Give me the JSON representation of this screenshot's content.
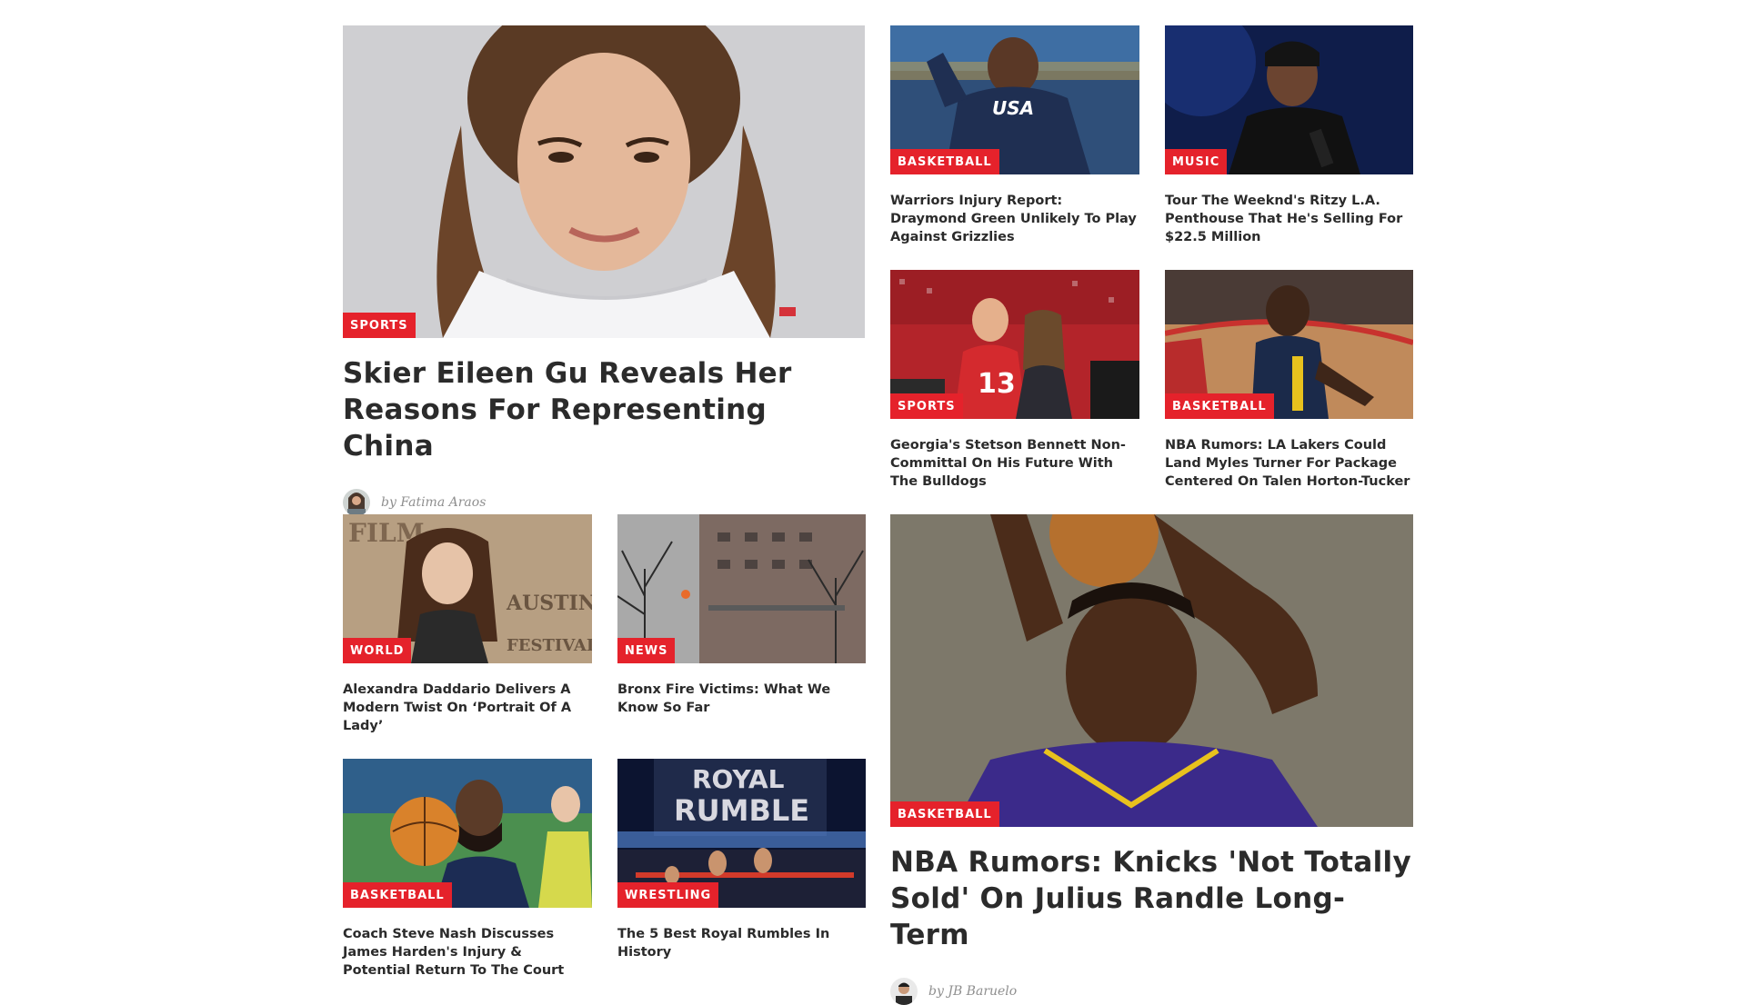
{
  "featured_left": {
    "category": "SPORTS",
    "title": "Skier Eileen Gu Reveals Her Reasons For Representing China",
    "by_prefix": "by",
    "author": "Fatima Araos"
  },
  "grid_top": [
    {
      "category": "BASKETBALL",
      "title": "Warriors Injury Report: Draymond Green Unlikely To Play Against Grizzlies"
    },
    {
      "category": "MUSIC",
      "title": "Tour The Weeknd's Ritzy L.A. Penthouse That He's Selling For $22.5 Million"
    },
    {
      "category": "SPORTS",
      "title": "Georgia's Stetson Bennett Non-Committal On His Future With The Bulldogs"
    },
    {
      "category": "BASKETBALL",
      "title": "NBA Rumors: LA Lakers Could Land Myles Turner For Package Centered On Talen Horton-Tucker"
    }
  ],
  "grid_bottom": [
    {
      "category": "WORLD",
      "title": "Alexandra Daddario Delivers A Modern Twist On ‘Portrait Of A Lady’"
    },
    {
      "category": "NEWS",
      "title": "Bronx Fire Victims: What We Know So Far"
    },
    {
      "category": "BASKETBALL",
      "title": "Coach Steve Nash Discusses James Harden's Injury & Potential Return To The Court"
    },
    {
      "category": "WRESTLING",
      "title": "The 5 Best Royal Rumbles In History"
    }
  ],
  "featured_right": {
    "category": "BASKETBALL",
    "title": "NBA Rumors: Knicks 'Not Totally Sold' On Julius Randle Long-Term",
    "by_prefix": "by",
    "author": "JB Baruelo"
  },
  "image_text": {
    "usa_jersey": "USA",
    "jersey_number": "13",
    "royal_rumble_line1": "ROYAL",
    "royal_rumble_line2": "RUMBLE",
    "film_festival_1": "FILM",
    "film_festival_2": "AUSTIN",
    "film_festival_3": "FESTIVAL"
  },
  "colors": {
    "badge": "#e5222b",
    "headline": "#2b2b2b",
    "byline": "#8f8f8f"
  }
}
